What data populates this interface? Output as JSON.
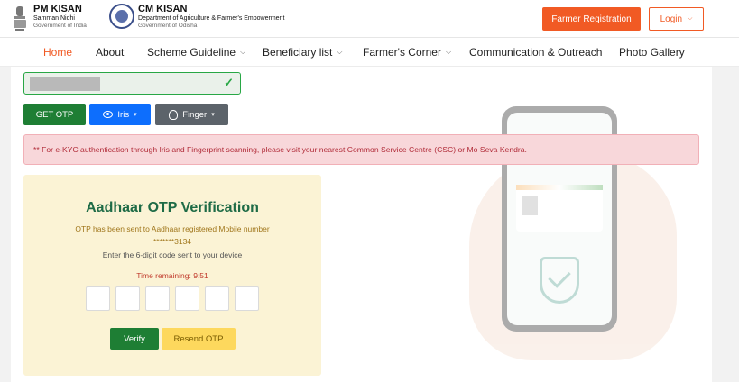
{
  "header": {
    "pm_kisan": {
      "title": "PM KISAN",
      "subtitle": "Samman Nidhi",
      "org": "Government of India"
    },
    "cm_kisan": {
      "title": "CM KISAN",
      "subtitle": "Department of Agriculture & Farmer's Empowerment",
      "org": "Government of Odisha"
    },
    "register_label": "Farmer Registration",
    "login_label": "Login"
  },
  "nav": {
    "items": [
      {
        "label": "Home",
        "active": true
      },
      {
        "label": "About"
      },
      {
        "label": "Scheme Guideline",
        "dropdown": true
      },
      {
        "label": "Beneficiary list",
        "dropdown": true
      },
      {
        "label": "Farmer's Corner",
        "dropdown": true
      },
      {
        "label": "Communication & Outreach"
      },
      {
        "label": "Photo Gallery"
      }
    ]
  },
  "ekyc": {
    "get_otp_label": "GET OTP",
    "iris_label": "Iris",
    "finger_label": "Finger",
    "alert_text": "** For e-KYC authentication through Iris and Fingerprint scanning, please visit your nearest Common Service Centre (CSC) or Mo Seva Kendra."
  },
  "otp": {
    "title": "Aadhaar OTP Verification",
    "sent_text": "OTP has been sent to Aadhaar registered Mobile number",
    "masked_mobile": "*******3134",
    "hint": "Enter the 6-digit code sent to your device",
    "timer_text": "Time remaining: 9:51",
    "verify_label": "Verify",
    "resend_label": "Resend OTP"
  },
  "colors": {
    "accent": "#f15a24",
    "success": "#1e7e34",
    "primary": "#0d6efd",
    "secondary": "#5c636a",
    "alert_bg": "#f8d7da",
    "otp_bg": "#fbf3d5"
  }
}
